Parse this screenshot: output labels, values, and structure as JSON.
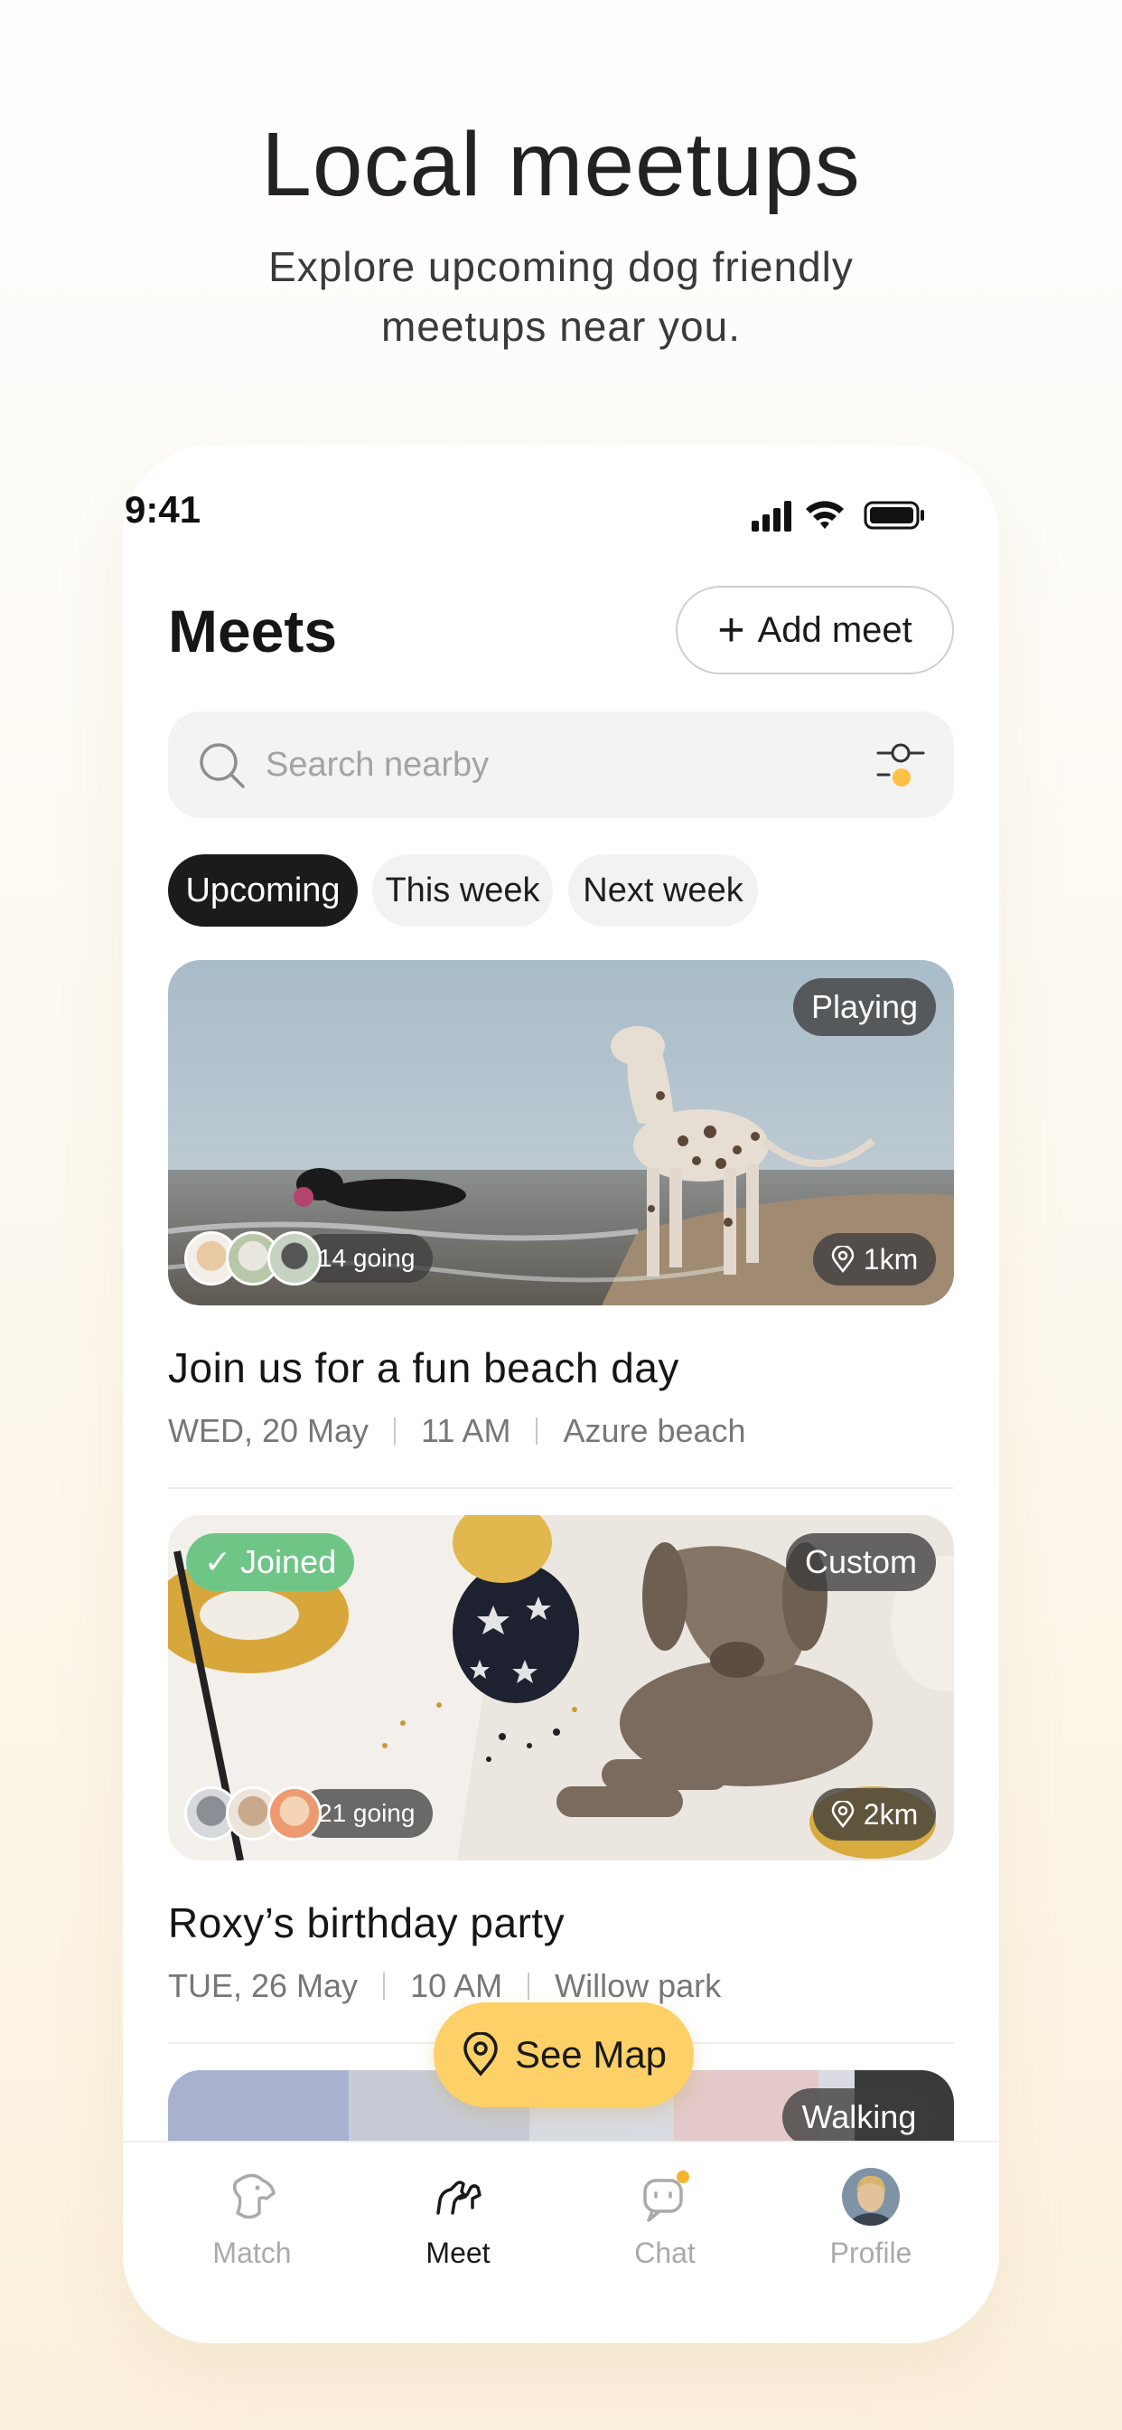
{
  "hero": {
    "title": "Local meetups",
    "subtitle": "Explore upcoming dog friendly meetups near you."
  },
  "status_bar": {
    "time": "9:41"
  },
  "header": {
    "title": "Meets",
    "add_label": "Add meet"
  },
  "search": {
    "placeholder": "Search nearby"
  },
  "filters": [
    "Upcoming",
    "This week",
    "Next week"
  ],
  "cards": [
    {
      "tag": "Playing",
      "going": "14 going",
      "distance": "1km",
      "title": "Join us for a fun beach day",
      "date": "WED, 20 May",
      "time": "11 AM",
      "place": "Azure beach"
    },
    {
      "joined": "Joined",
      "tag": "Custom",
      "going": "21 going",
      "distance": "2km",
      "title": "Roxy’s birthday party",
      "date": "TUE, 26 May",
      "time": "10 AM",
      "place": "Willow park"
    },
    {
      "tag": "Walking"
    }
  ],
  "see_map": "See Map",
  "tabbar": {
    "items": [
      {
        "label": "Match",
        "icon": "dog-head-icon"
      },
      {
        "label": "Meet",
        "icon": "two-dogs-icon"
      },
      {
        "label": "Chat",
        "icon": "chat-bubble-icon"
      },
      {
        "label": "Profile",
        "icon": "avatar"
      }
    ]
  },
  "colors": {
    "accent": "#fdd168",
    "joined": "#6fc586",
    "dark": "#1b1b1b"
  }
}
